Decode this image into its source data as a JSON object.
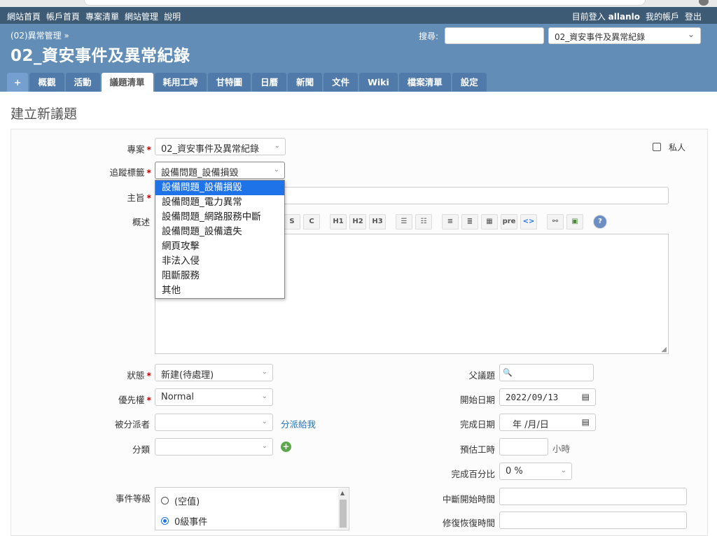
{
  "top_menu": {
    "left": [
      "網站首頁",
      "帳戶首頁",
      "專案清單",
      "網站管理",
      "說明"
    ],
    "logged_in_prefix": "目前登入",
    "user": "allanlo",
    "my_account": "我的帳戶",
    "logout": "登出"
  },
  "header": {
    "breadcrumb": "(02)異常管理 »",
    "title": "02_資安事件及異常紀錄",
    "search_label": "搜尋:",
    "project_jump": "02_資安事件及異常紀錄"
  },
  "main_menu": {
    "plus": "+",
    "tabs": [
      "概觀",
      "活動",
      "議題清單",
      "耗用工時",
      "甘特圖",
      "日曆",
      "新聞",
      "文件",
      "Wiki",
      "檔案清單",
      "設定"
    ],
    "selected": "議題清單"
  },
  "page": {
    "heading": "建立新議題"
  },
  "form": {
    "project_label": "專案",
    "project_value": "02_資安事件及異常紀錄",
    "private_label": "私人",
    "tracker_label": "追蹤標籤",
    "tracker_value": "設備問題_設備損毀",
    "tracker_options": [
      "設備問題_設備損毀",
      "設備問題_電力異常",
      "設備問題_網路服務中斷",
      "設備問題_設備遺失",
      "網頁攻擊",
      "非法入侵",
      "阻斷服務",
      "其他"
    ],
    "subject_label": "主旨",
    "description_label": "概述",
    "toolbar": [
      "S",
      "C",
      "H1",
      "H2",
      "H3",
      "ul",
      "ol",
      "left",
      "right",
      "table",
      "pre",
      "<>",
      "link",
      "img",
      "?"
    ],
    "status_label": "狀態",
    "status_value": "新建(待處理)",
    "priority_label": "優先權",
    "priority_value": "Normal",
    "assignee_label": "被分派者",
    "assign_to_me": "分派給我",
    "category_label": "分類",
    "parent_label": "父議題",
    "start_date_label": "開始日期",
    "start_date_value": "2022/09/13",
    "due_date_label": "完成日期",
    "due_date_value": "年 /月/日",
    "estimated_label": "預估工時",
    "hours_unit": "小時",
    "done_label": "完成百分比",
    "done_value": "0 %",
    "event_level_label": "事件等級",
    "event_levels": [
      "(空值)",
      "0級事件"
    ],
    "interrupt_start_label": "中斷開始時間",
    "recovery_label": "修復恢復時間"
  }
}
